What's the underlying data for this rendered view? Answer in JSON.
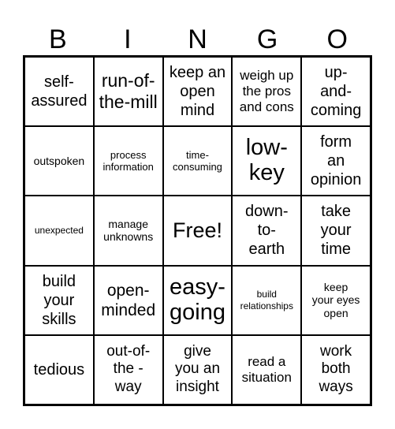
{
  "header": {
    "letters": [
      "B",
      "I",
      "N",
      "G",
      "O"
    ]
  },
  "grid": {
    "rows": [
      [
        "self-\nassured",
        "run-of-\nthe-mill",
        "keep an\nopen\nmind",
        "weigh up\nthe pros\nand cons",
        "up-\nand-\ncoming"
      ],
      [
        "outspoken",
        "process\ninformation",
        "time-\nconsuming",
        "low-\nkey",
        "form\nan\nopinion"
      ],
      [
        "unexpected",
        "manage\nunknowns",
        "Free!",
        "down-\nto-\nearth",
        "take\nyour\ntime"
      ],
      [
        "build\nyour\nskills",
        "open-\nminded",
        "easy-\ngoing",
        "build\nrelationships",
        "keep\nyour eyes\nopen"
      ],
      [
        "tedious",
        "out-of-\nthe -\nway",
        "give\nyou an\ninsight",
        "read a\nsituation",
        "work\nboth\nways"
      ]
    ]
  }
}
